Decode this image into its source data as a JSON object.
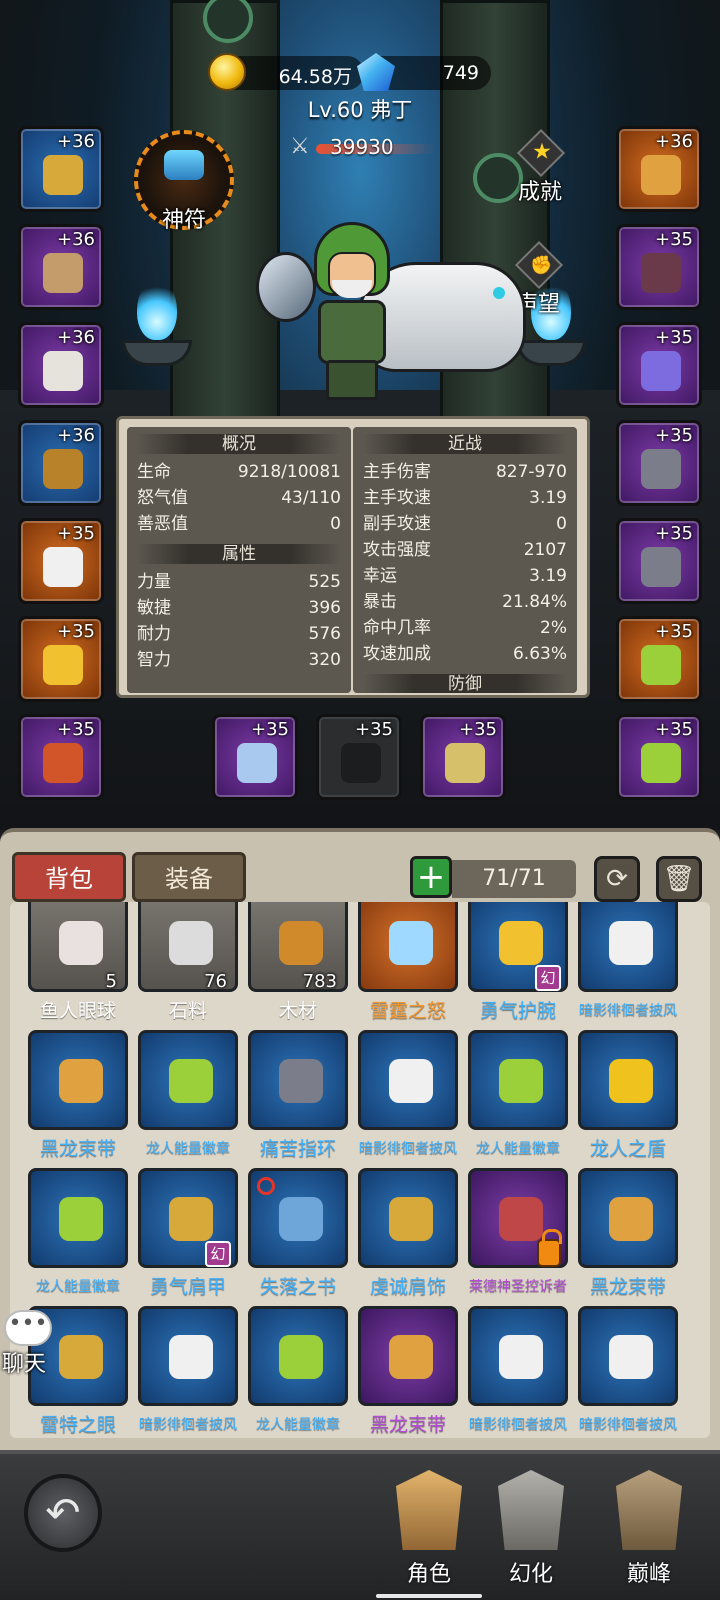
{
  "hud": {
    "gold": "64.58万",
    "gems": "749",
    "level_name": "Lv.60 弗丁",
    "power": "39930"
  },
  "side_buttons": {
    "talisman": "神符",
    "achievement": "成就",
    "reputation": "声望"
  },
  "equip_left": [
    {
      "plus": "+36",
      "rarity": "blue",
      "icon": "shoulder-armor-icon"
    },
    {
      "plus": "+36",
      "rarity": "purple",
      "icon": "necklace-icon"
    },
    {
      "plus": "+36",
      "rarity": "purple",
      "icon": "gauntlet-icon"
    },
    {
      "plus": "+36",
      "rarity": "blue",
      "icon": "chest-armor-icon"
    },
    {
      "plus": "+35",
      "rarity": "orange",
      "icon": "cloak-icon"
    },
    {
      "plus": "+35",
      "rarity": "orange",
      "icon": "bracer-icon"
    },
    {
      "plus": "+35",
      "rarity": "purple",
      "icon": "gloves-icon"
    }
  ],
  "equip_right": [
    {
      "plus": "+36",
      "rarity": "orange",
      "icon": "belt-icon"
    },
    {
      "plus": "+35",
      "rarity": "purple",
      "icon": "leg-armor-icon"
    },
    {
      "plus": "+35",
      "rarity": "purple",
      "icon": "boots-icon"
    },
    {
      "plus": "+35",
      "rarity": "purple",
      "icon": "ring-icon"
    },
    {
      "plus": "+35",
      "rarity": "purple",
      "icon": "ring-icon"
    },
    {
      "plus": "+35",
      "rarity": "orange",
      "icon": "amulet-icon"
    },
    {
      "plus": "+35",
      "rarity": "purple",
      "icon": "amulet-icon"
    }
  ],
  "equip_bottom": [
    {
      "plus": "+35",
      "rarity": "purple",
      "icon": "axe-icon"
    },
    {
      "plus": "+35",
      "rarity": "empty",
      "icon": "shield-slot-icon"
    },
    {
      "plus": "+35",
      "rarity": "purple",
      "icon": "dagger-icon"
    }
  ],
  "stats": {
    "overview_title": "概况",
    "overview": [
      {
        "k": "生命",
        "v": "9218/10081"
      },
      {
        "k": "怒气值",
        "v": "43/110"
      },
      {
        "k": "善恶值",
        "v": "0"
      }
    ],
    "attributes_title": "属性",
    "attributes": [
      {
        "k": "力量",
        "v": "525"
      },
      {
        "k": "敏捷",
        "v": "396"
      },
      {
        "k": "耐力",
        "v": "576"
      },
      {
        "k": "智力",
        "v": "320"
      }
    ],
    "melee_title": "近战",
    "melee": [
      {
        "k": "主手伤害",
        "v": "827-970"
      },
      {
        "k": "主手攻速",
        "v": "3.19"
      },
      {
        "k": "副手攻速",
        "v": "0"
      },
      {
        "k": "攻击强度",
        "v": "2107"
      },
      {
        "k": "幸运",
        "v": "3.19"
      },
      {
        "k": "暴击",
        "v": "21.84%"
      },
      {
        "k": "命中几率",
        "v": "2%"
      },
      {
        "k": "攻速加成",
        "v": "6.63%"
      }
    ],
    "defense_title": "防御"
  },
  "bag": {
    "tab_bag": "背包",
    "tab_equip": "装备",
    "add": "+",
    "capacity": "71/71",
    "items": [
      {
        "name": "鱼人眼球",
        "count": "5",
        "rarity": "gray",
        "color": "#ffffff",
        "icon": "eyeball-icon"
      },
      {
        "name": "石料",
        "count": "76",
        "rarity": "gray",
        "color": "#ffffff",
        "icon": "stone-icon"
      },
      {
        "name": "木材",
        "count": "783",
        "rarity": "gray",
        "color": "#ffffff",
        "icon": "wood-icon"
      },
      {
        "name": "雷霆之怒",
        "count": "",
        "rarity": "orange",
        "color": "#f5972b",
        "icon": "sword-icon"
      },
      {
        "name": "勇气护腕",
        "count": "",
        "rarity": "blue",
        "color": "#3fb1ff",
        "icon": "bracer-icon",
        "tag": "幻"
      },
      {
        "name": "暗影徘徊者披风",
        "count": "",
        "rarity": "blue",
        "color": "#3fb1ff",
        "icon": "cloak-icon",
        "small": true
      },
      {
        "name": "黑龙束带",
        "count": "",
        "rarity": "blue",
        "color": "#3fb1ff",
        "icon": "belt-icon"
      },
      {
        "name": "龙人能量徽章",
        "count": "",
        "rarity": "blue",
        "color": "#3fb1ff",
        "icon": "amulet-icon",
        "small": true
      },
      {
        "name": "痛苦指环",
        "count": "",
        "rarity": "blue",
        "color": "#3fb1ff",
        "icon": "ring-icon"
      },
      {
        "name": "暗影徘徊者披风",
        "count": "",
        "rarity": "blue",
        "color": "#3fb1ff",
        "icon": "cloak-icon",
        "small": true
      },
      {
        "name": "龙人能量徽章",
        "count": "",
        "rarity": "blue",
        "color": "#3fb1ff",
        "icon": "amulet-icon",
        "small": true
      },
      {
        "name": "龙人之盾",
        "count": "",
        "rarity": "blue",
        "color": "#3fb1ff",
        "icon": "shield-icon"
      },
      {
        "name": "龙人能量徽章",
        "count": "",
        "rarity": "blue",
        "color": "#3fb1ff",
        "icon": "amulet-icon",
        "small": true
      },
      {
        "name": "勇气肩甲",
        "count": "",
        "rarity": "blue",
        "color": "#3fb1ff",
        "icon": "shoulder-armor-icon",
        "tag": "幻"
      },
      {
        "name": "失落之书",
        "count": "",
        "rarity": "blue",
        "color": "#3fb1ff",
        "icon": "book-icon",
        "ban": true
      },
      {
        "name": "虔诚肩饰",
        "count": "",
        "rarity": "blue",
        "color": "#3fb1ff",
        "icon": "shoulder-armor-icon"
      },
      {
        "name": "莱德神圣控诉者",
        "count": "",
        "rarity": "purple",
        "color": "#b44bd8",
        "icon": "scythe-icon",
        "small": true,
        "lock": true
      },
      {
        "name": "黑龙束带",
        "count": "",
        "rarity": "blue",
        "color": "#3fb1ff",
        "icon": "belt-icon"
      },
      {
        "name": "雷特之眼",
        "count": "",
        "rarity": "blue",
        "color": "#3fb1ff",
        "icon": "shoulder-armor-icon"
      },
      {
        "name": "暗影徘徊者披风",
        "count": "",
        "rarity": "blue",
        "color": "#3fb1ff",
        "icon": "cloak-icon",
        "small": true
      },
      {
        "name": "龙人能量徽章",
        "count": "",
        "rarity": "blue",
        "color": "#3fb1ff",
        "icon": "amulet-icon",
        "small": true
      },
      {
        "name": "黑龙束带",
        "count": "",
        "rarity": "purple",
        "color": "#b44bd8",
        "icon": "belt-icon"
      },
      {
        "name": "暗影徘徊者披风",
        "count": "",
        "rarity": "blue",
        "color": "#3fb1ff",
        "icon": "cloak-icon",
        "small": true
      },
      {
        "name": "暗影徘徊者披风",
        "count": "",
        "rarity": "blue",
        "color": "#3fb1ff",
        "icon": "cloak-icon",
        "small": true
      }
    ]
  },
  "chat": {
    "label": "聊天",
    "bubble": "•••"
  },
  "nav": {
    "back": "↶",
    "role": "角色",
    "morph": "幻化",
    "peak": "巅峰"
  }
}
